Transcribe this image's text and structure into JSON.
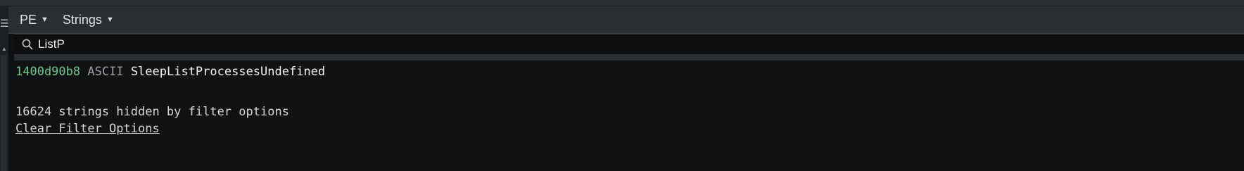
{
  "toolbar": {
    "format_menu": "PE",
    "view_menu": "Strings"
  },
  "search": {
    "value": "ListP"
  },
  "results": [
    {
      "address": "1400d90b8",
      "encoding": "ASCII",
      "text": "SleepListProcessesUndefined"
    }
  ],
  "filter": {
    "hidden_notice": "16624 strings hidden by filter options",
    "clear_link": "Clear Filter Options"
  },
  "icons": {
    "search": "search-icon",
    "menu_caret": "caret-down-icon",
    "sidebar_handle": "menu-icon",
    "scroll_up": "scroll-up-icon"
  },
  "colors": {
    "address": "#6fc789",
    "encoding": "#9a9da1",
    "background": "#0f1112"
  }
}
